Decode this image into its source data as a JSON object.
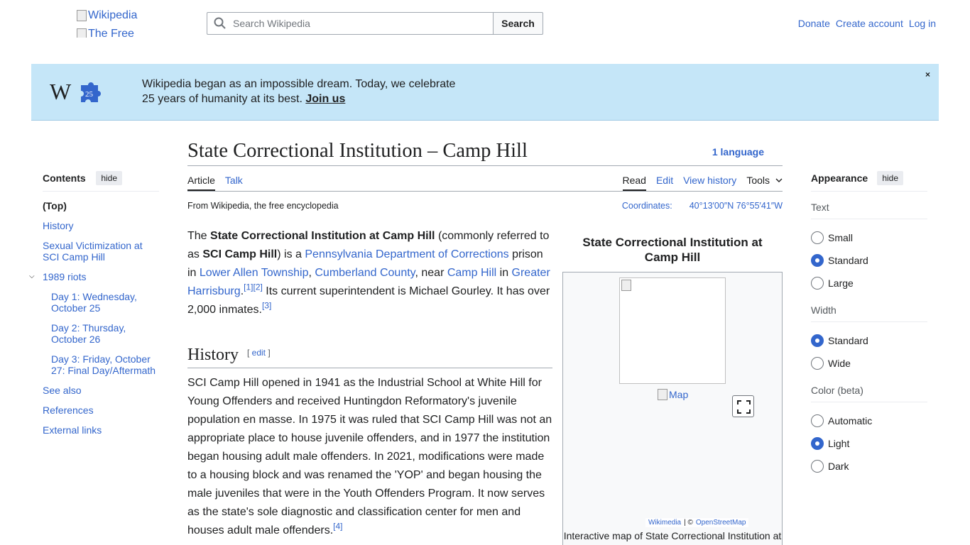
{
  "header": {
    "logo_alt1": "Wikipedia",
    "logo_alt2": "The Free",
    "search_placeholder": "Search Wikipedia",
    "search_button": "Search",
    "donate": "Donate",
    "create_account": "Create account",
    "log_in": "Log in"
  },
  "banner": {
    "line1": "Wikipedia began as an impossible dream. Today, we celebrate",
    "line2": "25 years of humanity at its best.",
    "join": "Join us",
    "close": "×",
    "badge": "25"
  },
  "toc": {
    "title": "Contents",
    "hide": "hide",
    "items": [
      "(Top)",
      "History",
      "Sexual Victimization at SCI Camp Hill",
      "1989 riots",
      "Day 1: Wednesday, October 25",
      "Day 2: Thursday, October 26",
      "Day 3: Friday, October 27: Final Day/Aftermath",
      "See also",
      "References",
      "External links"
    ]
  },
  "article": {
    "title": "State Correctional Institution – Camp Hill",
    "language": "1 language",
    "tabs": {
      "article": "Article",
      "talk": "Talk",
      "read": "Read",
      "edit": "Edit",
      "history": "View history",
      "tools": "Tools"
    },
    "tagline": "From Wikipedia, the free encyclopedia",
    "coords_label": "Coordinates:",
    "coords_value": "40°13′00″N 76°55′41″W",
    "intro": {
      "t1": "The ",
      "b1": "State Correctional Institution at Camp Hill",
      "t2": " (commonly referred to as ",
      "b2": "SCI Camp Hill",
      "t3": ") is a ",
      "l1": "Pennsylvania Department of Corrections",
      "t4": " prison in ",
      "l2": "Lower Allen Township",
      "t5": ", ",
      "l3": "Cumberland County",
      "t6": ", near ",
      "l4": "Camp Hill",
      "t7": " in ",
      "l5": "Greater Harrisburg",
      "t8": ".",
      "r1": "[1]",
      "r2": "[2]",
      "t9": " Its current superintendent is Michael Gourley. It has over 2,000 inmates.",
      "r3": "[3]"
    },
    "history_heading": "History",
    "edit_open": "[ ",
    "edit_label": "edit",
    "edit_close": " ]",
    "history_text": "SCI Camp Hill opened in 1941 as the Industrial School at White Hill for Young Offenders and received Huntingdon Reformatory's juvenile population en masse. In 1975 it was ruled that SCI Camp Hill was not an appropriate place to house juvenile offenders, and in 1977 the institution began housing adult male offenders. In 2021, modifications were made to a housing block and was renamed the 'YOP' and began housing the male juveniles that were in the Youth Offenders Program. It now serves as the state's sole diagnostic and classification center for men and houses adult male offenders.",
    "history_ref": "[4]"
  },
  "infobox": {
    "title": "State Correctional Institution at Camp Hill",
    "map_alt": "Map",
    "attrib_wikimedia": "Wikimedia",
    "attrib_sep": "| ©",
    "attrib_osm": "OpenStreetMap",
    "caption": "Interactive map of State Correctional Institution at Camp Hill"
  },
  "appearance": {
    "title": "Appearance",
    "hide": "hide",
    "text_label": "Text",
    "text_options": [
      "Small",
      "Standard",
      "Large"
    ],
    "width_label": "Width",
    "width_options": [
      "Standard",
      "Wide"
    ],
    "color_label": "Color (beta)",
    "color_options": [
      "Automatic",
      "Light",
      "Dark"
    ]
  },
  "colors": {
    "link": "#3366cc",
    "banner": "#c5e6f8",
    "text": "#202122"
  }
}
